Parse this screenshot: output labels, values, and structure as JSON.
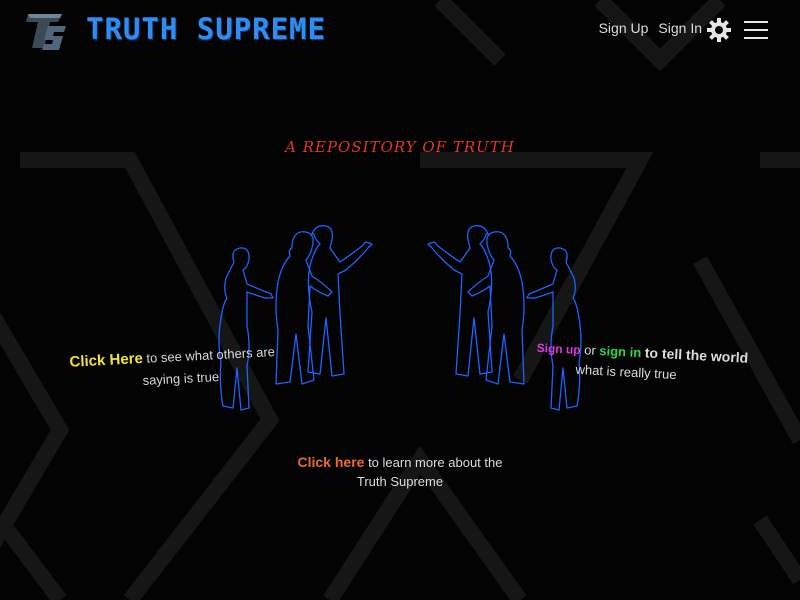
{
  "header": {
    "logo_icon": "logo-ts-icon",
    "brand_title": "TRUTH SUPREME",
    "nav": {
      "signup_label": "Sign Up",
      "signin_label": "Sign In"
    },
    "settings_icon": "gear-icon",
    "menu_icon": "hamburger-menu-icon"
  },
  "main": {
    "tagline": "A REPOSITORY OF TRUTH",
    "illustration_icon": "people-silhouettes-illustration",
    "left_cta": {
      "link_label": "Click Here",
      "text_1": "to see what others are",
      "text_2": "saying is true"
    },
    "right_cta": {
      "signup_label": "Sign up",
      "or_text": "or",
      "signin_label": "sign in",
      "text_1": "to tell the world",
      "text_2": "what is really true"
    },
    "bottom_cta": {
      "link_label": "Click here",
      "text_1": "to learn more about the",
      "text_2": "Truth Supreme"
    }
  },
  "colors": {
    "background": "#030303",
    "brand": "#2f8df2",
    "tagline": "#e1362a",
    "click_here_yellow": "#f4e23c",
    "signup_magenta": "#d63ad8",
    "signin_green": "#2fd64a",
    "click_here_orange": "#ec6a2e",
    "figure_outline": "#1d63ff"
  }
}
